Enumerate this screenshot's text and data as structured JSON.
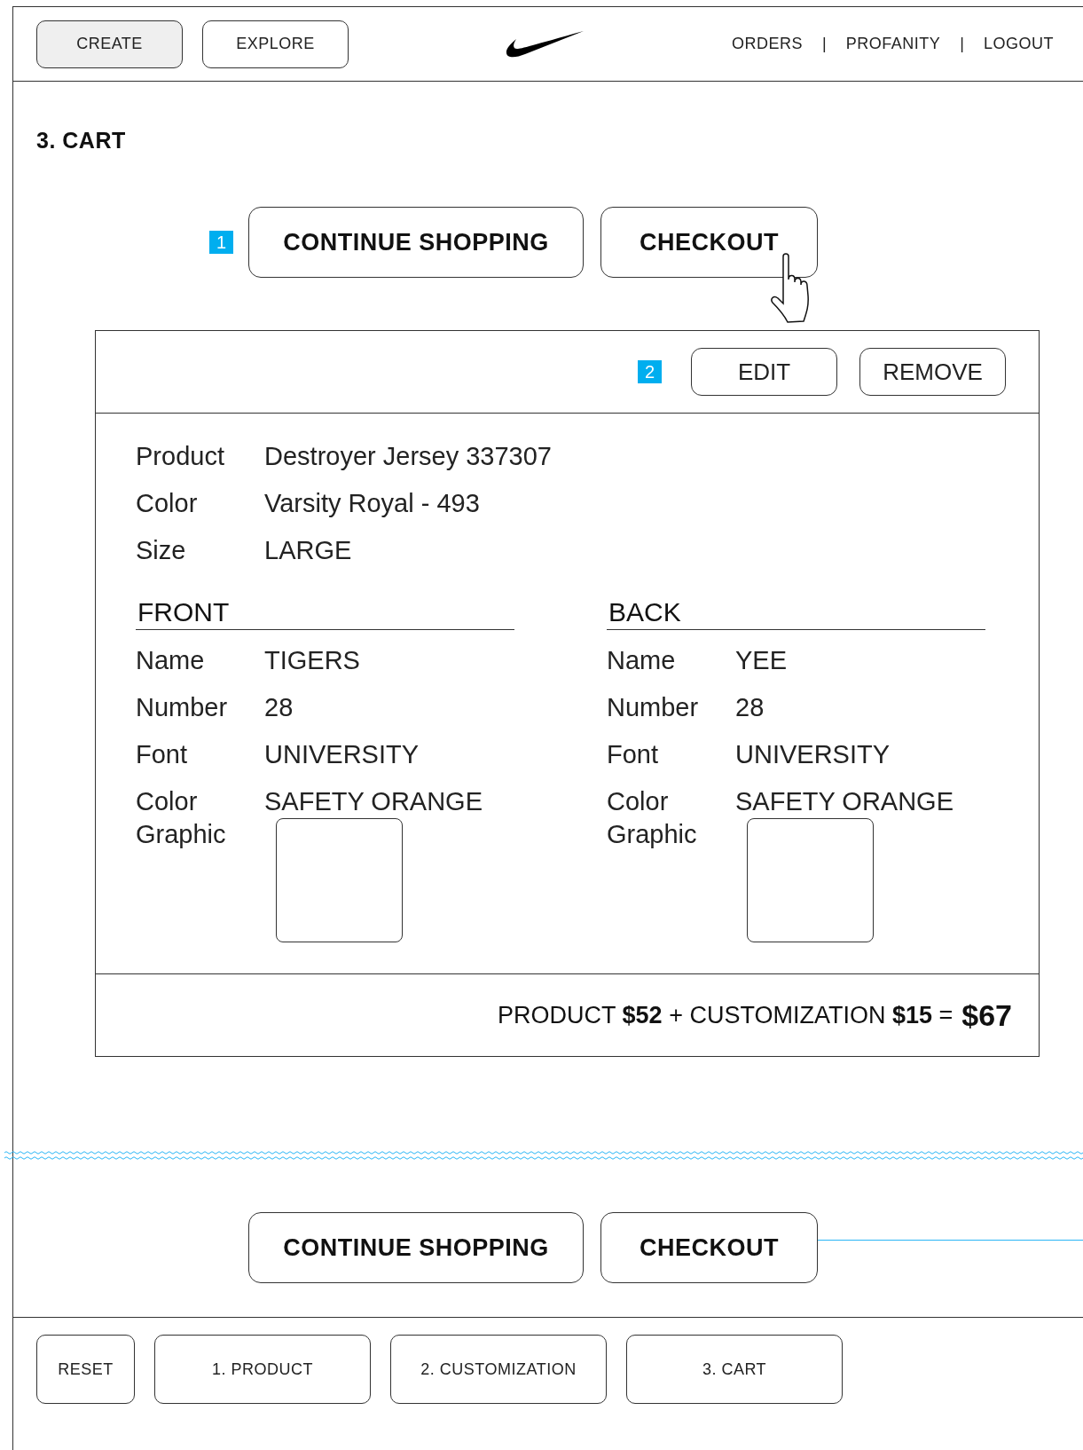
{
  "header": {
    "nav_buttons": [
      {
        "label": "CREATE",
        "selected": true
      },
      {
        "label": "EXPLORE",
        "selected": false
      }
    ],
    "links": [
      "ORDERS",
      "PROFANITY",
      "LOGOUT"
    ],
    "separator": "|"
  },
  "page_title": "3. CART",
  "top_actions": {
    "marker": "1",
    "buttons": [
      "CONTINUE SHOPPING",
      "CHECKOUT"
    ]
  },
  "cart_item": {
    "marker": "2",
    "actions": [
      "EDIT",
      "REMOVE"
    ],
    "details": [
      {
        "label": "Product",
        "value": "Destroyer Jersey 337307"
      },
      {
        "label": "Color",
        "value": "Varsity Royal  - 493"
      },
      {
        "label": "Size",
        "value": "LARGE"
      }
    ],
    "sides": [
      {
        "title": "FRONT",
        "fields": [
          {
            "label": "Name",
            "value": "TIGERS"
          },
          {
            "label": "Number",
            "value": "28"
          },
          {
            "label": "Font",
            "value": "UNIVERSITY"
          },
          {
            "label": "Color",
            "value": "SAFETY ORANGE"
          }
        ],
        "graphic_label": "Graphic"
      },
      {
        "title": "BACK",
        "fields": [
          {
            "label": "Name",
            "value": "YEE"
          },
          {
            "label": "Number",
            "value": "28"
          },
          {
            "label": "Font",
            "value": "UNIVERSITY"
          },
          {
            "label": "Color",
            "value": "SAFETY ORANGE"
          }
        ],
        "graphic_label": "Graphic"
      }
    ],
    "price_breakdown": "PRODUCT  **$52** + CUSTOMIZATION **$15** =",
    "total": "$67"
  },
  "bottom_actions": {
    "buttons": [
      "CONTINUE SHOPPING",
      "CHECKOUT"
    ]
  },
  "step_nav": [
    {
      "label": "RESET",
      "selected": false
    },
    {
      "label": "1. PRODUCT",
      "selected": false
    },
    {
      "label": "2. CUSTOMIZATION",
      "selected": false
    },
    {
      "label": "3. CART",
      "selected": false
    }
  ]
}
